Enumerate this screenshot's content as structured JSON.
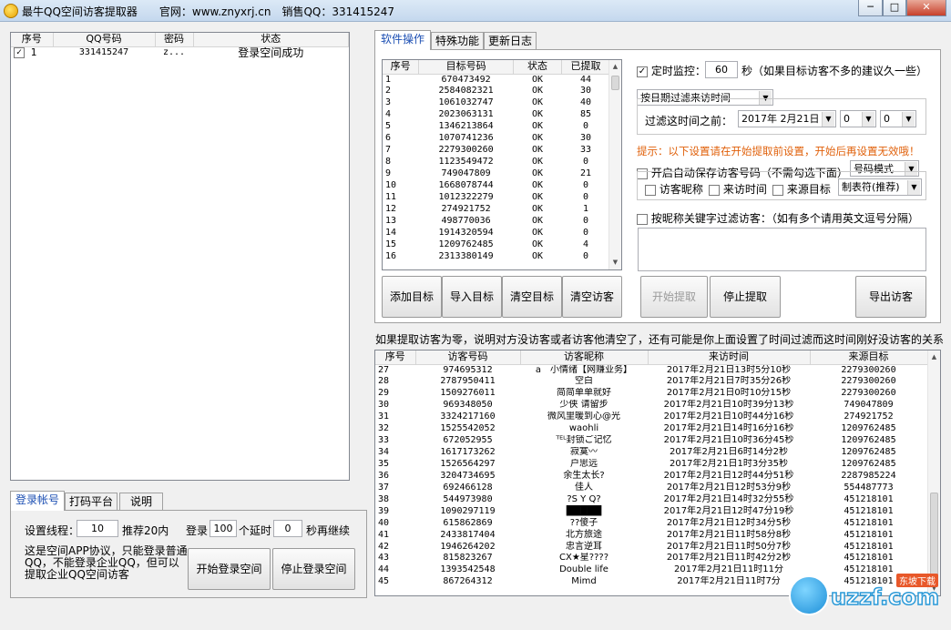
{
  "window": {
    "title": "最牛QQ空间访客提取器　　官网：www.znyxrj.cn　销售QQ：331415247",
    "min": "─",
    "max": "□",
    "close": "✕"
  },
  "account_list": {
    "headers": [
      "序号",
      "QQ号码",
      "密码",
      "状态"
    ],
    "rows": [
      {
        "no": "1",
        "qq": "331415247",
        "pwd": "z...",
        "status": "登录空间成功",
        "checked": true
      }
    ]
  },
  "left_tabs": [
    {
      "label": "登录帐号"
    },
    {
      "label": "打码平台"
    },
    {
      "label": "说明"
    }
  ],
  "login": {
    "threads_label": "设置线程：",
    "threads_value": "10",
    "threads_hint": "推荐20内",
    "login_label": "登录",
    "login_count": "100",
    "delay_label": "个延时",
    "delay_value": "0",
    "resume_label": "秒再继续",
    "note": "这是空间APP协议，只能登录普通QQ，不能登录企业QQ，但可以提取企业QQ空间访客",
    "start_button": "开始登录空间",
    "stop_button": "停止登录空间"
  },
  "right_tabs": [
    {
      "label": "软件操作"
    },
    {
      "label": "特殊功能"
    },
    {
      "label": "更新日志"
    }
  ],
  "targets": {
    "headers": [
      "序号",
      "目标号码",
      "状态",
      "已提取"
    ],
    "rows": [
      [
        "1",
        "670473492",
        "OK",
        "44"
      ],
      [
        "2",
        "2584082321",
        "OK",
        "30"
      ],
      [
        "3",
        "1061032747",
        "OK",
        "40"
      ],
      [
        "4",
        "2023063131",
        "OK",
        "85"
      ],
      [
        "5",
        "1346213864",
        "OK",
        "0"
      ],
      [
        "6",
        "1070741236",
        "OK",
        "30"
      ],
      [
        "7",
        "2279300260",
        "OK",
        "33"
      ],
      [
        "8",
        "1123549472",
        "OK",
        "0"
      ],
      [
        "9",
        "749047809",
        "OK",
        "21"
      ],
      [
        "10",
        "1668078744",
        "OK",
        "0"
      ],
      [
        "11",
        "1012322279",
        "OK",
        "0"
      ],
      [
        "12",
        "274921752",
        "OK",
        "1"
      ],
      [
        "13",
        "498770036",
        "OK",
        "0"
      ],
      [
        "14",
        "1914320594",
        "OK",
        "0"
      ],
      [
        "15",
        "1209762485",
        "OK",
        "4"
      ],
      [
        "16",
        "2313380149",
        "OK",
        "0"
      ]
    ]
  },
  "target_buttons": {
    "add": "添加目标",
    "import": "导入目标",
    "clear_target": "清空目标",
    "clear_visitor": "清空访客"
  },
  "action_buttons": {
    "start": "开始提取",
    "stop": "停止提取",
    "export": "导出访客"
  },
  "settings": {
    "timer_label": "定时监控：",
    "timer_value": "60",
    "timer_unit": "秒（如果目标访客不多的建议久一些）",
    "filter_mode": "按日期过滤来访时间",
    "filter_before_label": "过滤这时间之前：",
    "filter_date": "2017年 2月21日",
    "filter_hour": "0",
    "filter_min": "0",
    "hint": "提示：以下设置请在开始提取前设置，开始后再设置无效哦！",
    "autosave_label": "开启自动保存访客号码（不需勾选下面）",
    "autosave_mode": "号码模式",
    "opt_nickname": "访客昵称",
    "opt_time": "来访时间",
    "opt_source": "来源目标",
    "separator": "制表符(推荐)",
    "keyword_label": "按昵称关键字过滤访客：（如有多个请用英文逗号分隔）"
  },
  "info_text": "如果提取访客为零，说明对方没访客或者访客他清空了，还有可能是你上面设置了时间过滤而这时间刚好没访客的关系",
  "visitors": {
    "headers": [
      "序号",
      "访客号码",
      "访客昵称",
      "来访时间",
      "来源目标"
    ],
    "rows": [
      [
        "27",
        "974695312",
        "a　小情绪【网赚业务】",
        "2017年2月21日13时5分10秒",
        "2279300260"
      ],
      [
        "28",
        "2787950411",
        "空白",
        "2017年2月21日7时35分26秒",
        "2279300260"
      ],
      [
        "29",
        "1509276011",
        "简简单单就好",
        "2017年2月21日0时10分15秒",
        "2279300260"
      ],
      [
        "30",
        "969348050",
        "少侠 请留步",
        "2017年2月21日10时39分13秒",
        "749047809"
      ],
      [
        "31",
        "3324217160",
        "微风里暖到心@光",
        "2017年2月21日10时44分16秒",
        "274921752"
      ],
      [
        "32",
        "1525542052",
        "waohli",
        "2017年2月21日14时16分16秒",
        "1209762485"
      ],
      [
        "33",
        "672052955",
        "ᵀᴱᴸ封锁ご记忆",
        "2017年2月21日10时36分45秒",
        "1209762485"
      ],
      [
        "34",
        "1617173262",
        "寂寞〰",
        "2017年2月21日6时14分2秒",
        "1209762485"
      ],
      [
        "35",
        "1526564297",
        "户思远",
        "2017年2月21日1时3分35秒",
        "1209762485"
      ],
      [
        "36",
        "3204734695",
        "余生太长?",
        "2017年2月21日12时44分51秒",
        "2287985224"
      ],
      [
        "37",
        "692466128",
        "佳人",
        "2017年2月21日12时53分9秒",
        "554487773"
      ],
      [
        "38",
        "544973980",
        "?S Y Q?",
        "2017年2月21日14时32分55秒",
        "451218101"
      ],
      [
        "39",
        "1090297119",
        "█████",
        "2017年2月21日12时47分19秒",
        "451218101"
      ],
      [
        "40",
        "615862869",
        "??傻子",
        "2017年2月21日12时34分5秒",
        "451218101"
      ],
      [
        "41",
        "2433817404",
        "北方旅途",
        "2017年2月21日11时58分8秒",
        "451218101"
      ],
      [
        "42",
        "1946264202",
        "忠言逆耳",
        "2017年2月21日11时50分7秒",
        "451218101"
      ],
      [
        "43",
        "815823267",
        "CX★星????",
        "2017年2月21日11时42分2秒",
        "451218101"
      ],
      [
        "44",
        "1393542548",
        "Double life",
        "2017年2月21日11时11分",
        "451218101"
      ],
      [
        "45",
        "867264312",
        "Mimd",
        "2017年2月21日11时7分",
        "451218101"
      ]
    ]
  },
  "watermark": {
    "logo": "uzzf.com",
    "sub": "东坡下载"
  }
}
